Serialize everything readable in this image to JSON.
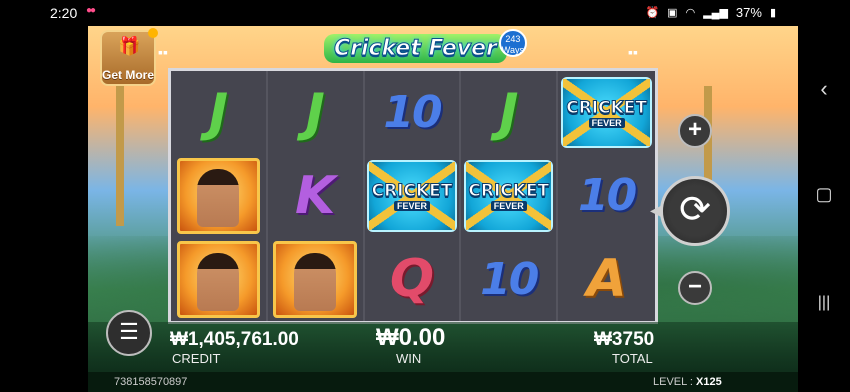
{
  "status": {
    "time": "2:20",
    "battery": "37%"
  },
  "game": {
    "title": "Cricket Fever",
    "ways": "243 Ways",
    "get_more": "Get More",
    "reels": [
      [
        "J",
        "J",
        "10",
        "J",
        "WILD"
      ],
      [
        "PLAYER",
        "K",
        "WILD",
        "WILD",
        "10"
      ],
      [
        "PLAYER",
        "PLAYER",
        "Q",
        "10",
        "A"
      ]
    ],
    "wild_text": {
      "line1": "CRICKET",
      "line2": "FEVER"
    },
    "credit": {
      "value": "₩1,405,761.00",
      "label": "CREDIT"
    },
    "win": {
      "value": "₩0.00",
      "label": "WIN"
    },
    "total": {
      "value": "₩3750",
      "label": "TOTAL"
    },
    "footer_id": "738158570897",
    "level": {
      "label": "LEVEL :",
      "value": "X125"
    }
  },
  "nav": {
    "back": "‹",
    "home": "▢",
    "recents": "|||"
  }
}
